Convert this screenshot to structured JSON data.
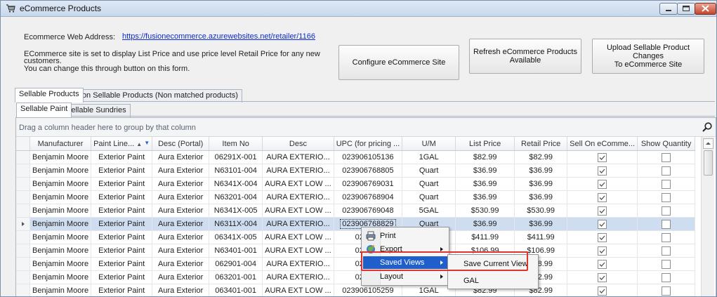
{
  "window": {
    "title": "eCommerce Products",
    "icon": "shopping-cart-icon"
  },
  "header": {
    "web_address_label": "Ecommerce Web Address:",
    "web_address_url": "https://fusionecommerce.azurewebsites.net/retailer/1166",
    "info_line1": "ECommerce site is set to display List Price and use price level Retail Price for any new",
    "info_line2": "customers.",
    "info_line3": "You can change this through button on this form."
  },
  "buttons": {
    "configure": "Configure eCommerce Site",
    "refresh_line1": "Refresh eCommerce Products",
    "refresh_line2": "Available",
    "upload_line1": "Upload Sellable Product Changes",
    "upload_line2": "To eCommerce Site"
  },
  "tabs": {
    "outer": [
      "Sellable Products",
      "Non Sellable Products (Non matched products)"
    ],
    "inner": [
      "Sellable Paint",
      "Sellable Sundries"
    ]
  },
  "grid": {
    "group_hint": "Drag a column header here to group by that column",
    "columns": [
      "Manufacturer",
      "Paint Line...",
      "Desc (Portal)",
      "Item No",
      "Desc",
      "UPC (for pricing ...",
      "U/M",
      "List Price",
      "Retail Price",
      "Sell On eComme...",
      "Show Quantity"
    ],
    "rows": [
      [
        "Benjamin Moore",
        "Exterior Paint",
        "Aura Exterior",
        "06291X-001",
        "AURA EXTERIO...",
        "023906105136",
        "1GAL",
        "$82.99",
        "$82.99",
        true,
        false
      ],
      [
        "Benjamin Moore",
        "Exterior Paint",
        "Aura Exterior",
        "N63101-004",
        "AURA EXTERIO...",
        "023906768805",
        "Quart",
        "$36.99",
        "$36.99",
        true,
        false
      ],
      [
        "Benjamin Moore",
        "Exterior Paint",
        "Aura Exterior",
        "N6341X-004",
        "AURA EXT LOW ...",
        "023906769031",
        "Quart",
        "$36.99",
        "$36.99",
        true,
        false
      ],
      [
        "Benjamin Moore",
        "Exterior Paint",
        "Aura Exterior",
        "N63201-004",
        "AURA EXTERIO...",
        "023906768904",
        "Quart",
        "$36.99",
        "$36.99",
        true,
        false
      ],
      [
        "Benjamin Moore",
        "Exterior Paint",
        "Aura Exterior",
        "N6341X-005",
        "AURA EXT LOW ...",
        "023906769048",
        "5GAL",
        "$530.99",
        "$530.99",
        true,
        false
      ],
      [
        "Benjamin Moore",
        "Exterior Paint",
        "Aura Exterior",
        "N6311X-004",
        "AURA EXTERIO...",
        "023906768829",
        "Quart",
        "$36.99",
        "$36.99",
        true,
        false
      ],
      [
        "Benjamin Moore",
        "Exterior Paint",
        "Aura Exterior",
        "06341X-005",
        "AURA EXT LOW ...",
        "023906",
        "",
        "$411.99",
        "$411.99",
        true,
        false
      ],
      [
        "Benjamin Moore",
        "Exterior Paint",
        "Aura Exterior",
        "N63401-001",
        "AURA EXT LOW ...",
        "023906",
        "",
        "$106.99",
        "$106.99",
        true,
        false
      ],
      [
        "Benjamin Moore",
        "Exterior Paint",
        "Aura Exterior",
        "062901-004",
        "AURA EXTERIO...",
        "023906",
        "",
        "$28.99",
        "$28.99",
        true,
        false
      ],
      [
        "Benjamin Moore",
        "Exterior Paint",
        "Aura Exterior",
        "063201-001",
        "AURA EXTERIO...",
        "023906",
        "",
        "$82.99",
        "$82.99",
        true,
        false
      ],
      [
        "Benjamin Moore",
        "Exterior Paint",
        "Aura Exterior",
        "063401-001",
        "AURA EXT LOW ...",
        "023906105259",
        "1GAL",
        "$82.99",
        "$82.99",
        true,
        false
      ]
    ],
    "selected_row": 5
  },
  "context_menu": {
    "items": [
      {
        "label": "Print",
        "icon": "printer-icon"
      },
      {
        "label": "Export",
        "icon": "export-icon"
      },
      {
        "label": "Saved Views",
        "icon": ""
      },
      {
        "label": "Layout",
        "icon": ""
      }
    ],
    "submenu": [
      "Save Current View",
      "GAL"
    ]
  },
  "colors": {
    "link": "#0b2bd3",
    "selection": "#cfddf1",
    "menu_highlight": "#1f5fcc",
    "annotation_red": "#e0332f"
  }
}
